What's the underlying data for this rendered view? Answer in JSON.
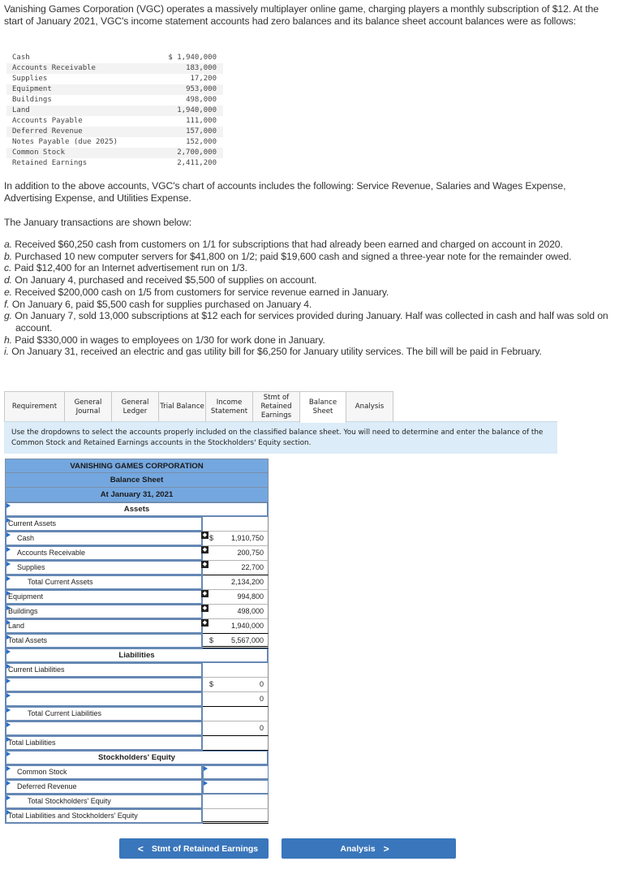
{
  "intro": {
    "p1": "Vanishing Games Corporation (VGC) operates a massively multiplayer online game, charging players a monthly subscription of $12. At the start of January 2021, VGC's income statement accounts had zero balances and its balance sheet account balances were as follows:",
    "p2": "In addition to the above accounts, VGC's chart of accounts includes the following: Service Revenue, Salaries and Wages Expense, Advertising Expense, and Utilities Expense.",
    "p3": "The January transactions are shown below:"
  },
  "beginning_balances": [
    {
      "account": "Cash",
      "amount": "$ 1,940,000"
    },
    {
      "account": "Accounts Receivable",
      "amount": "183,000"
    },
    {
      "account": "Supplies",
      "amount": "17,200"
    },
    {
      "account": "Equipment",
      "amount": "953,000"
    },
    {
      "account": "Buildings",
      "amount": "498,000"
    },
    {
      "account": "Land",
      "amount": "1,940,000"
    },
    {
      "account": "Accounts Payable",
      "amount": "111,000"
    },
    {
      "account": "Deferred Revenue",
      "amount": "157,000"
    },
    {
      "account": "Notes Payable (due 2025)",
      "amount": "152,000"
    },
    {
      "account": "Common Stock",
      "amount": "2,700,000"
    },
    {
      "account": "Retained Earnings",
      "amount": "2,411,200"
    }
  ],
  "transactions": [
    {
      "letter": "a.",
      "text": "Received $60,250 cash from customers on 1/1 for subscriptions that had already been earned and charged on account in 2020."
    },
    {
      "letter": "b.",
      "text": "Purchased 10 new computer servers for $41,800 on 1/2; paid $19,600 cash and signed a three-year note for the remainder owed."
    },
    {
      "letter": "c.",
      "text": "Paid $12,400 for an Internet advertisement run on 1/3."
    },
    {
      "letter": "d.",
      "text": "On January 4, purchased and received $5,500 of supplies on account."
    },
    {
      "letter": "e.",
      "text": "Received $200,000 cash on 1/5 from customers for service revenue earned in January."
    },
    {
      "letter": "f.",
      "text": "On January 6, paid $5,500 cash for supplies purchased on January 4."
    },
    {
      "letter": "g.",
      "text": "On January 7, sold 13,000 subscriptions at $12 each for services provided during January. Half was collected in cash and half was sold on account."
    },
    {
      "letter": "h.",
      "text": "Paid $330,000 in wages to employees on 1/30 for work done in January."
    },
    {
      "letter": "i.",
      "text": "On January 31, received an electric and gas utility bill for $6,250 for January utility services. The bill will be paid in February."
    }
  ],
  "tabs": [
    {
      "label": "Requirement",
      "active": false
    },
    {
      "label": "General Journal",
      "active": false
    },
    {
      "label": "General Ledger",
      "active": false
    },
    {
      "label": "Trial Balance",
      "active": false
    },
    {
      "label": "Income Statement",
      "active": false
    },
    {
      "label": "Stmt of Retained Earnings",
      "active": false
    },
    {
      "label": "Balance Sheet",
      "active": true
    },
    {
      "label": "Analysis",
      "active": false
    }
  ],
  "instructions": "Use the dropdowns to select the accounts properly included on the classified balance sheet. You will need to determine and enter the balance of the Common Stock and Retained Earnings accounts in the Stockholders' Equity section.",
  "balance_sheet": {
    "company": "VANISHING GAMES CORPORATION",
    "title": "Balance Sheet",
    "date": "At January 31, 2021",
    "assets_heading": "Assets",
    "liabilities_heading": "Liabilities",
    "equity_heading": "Stockholders' Equity",
    "rows": {
      "current_assets": {
        "label": "Current Assets",
        "value": ""
      },
      "cash": {
        "label": "Cash",
        "dollar": "$",
        "value": "1,910,750"
      },
      "accounts_receivable": {
        "label": "Accounts Receivable",
        "value": "200,750"
      },
      "supplies": {
        "label": "Supplies",
        "value": "22,700"
      },
      "total_current_assets": {
        "label": "Total Current Assets",
        "value": "2,134,200"
      },
      "equipment": {
        "label": "Equipment",
        "value": "994,800"
      },
      "buildings": {
        "label": "Buildings",
        "value": "498,000"
      },
      "land": {
        "label": "Land",
        "value": "1,940,000"
      },
      "total_assets": {
        "label": "Total Assets",
        "dollar": "$",
        "value": "5,567,000"
      },
      "current_liabilities": {
        "label": "Current Liabilities",
        "value": ""
      },
      "cl_line1": {
        "label": "",
        "dollar": "$",
        "value": "0"
      },
      "cl_line2": {
        "label": "",
        "value": "0"
      },
      "total_current_liabilities": {
        "label": "Total Current Liabilities",
        "value": ""
      },
      "ncl_line1": {
        "label": "",
        "value": "0"
      },
      "total_liabilities": {
        "label": "Total Liabilities",
        "value": ""
      },
      "common_stock": {
        "label": "Common Stock",
        "value": ""
      },
      "deferred_revenue": {
        "label": "Deferred Revenue",
        "value": ""
      },
      "total_equity": {
        "label": "Total Stockholders' Equity",
        "value": ""
      },
      "total_liab_equity": {
        "label": "Total Liabilities and Stockholders' Equity",
        "value": ""
      }
    }
  },
  "nav": {
    "prev_label": "Stmt of Retained Earnings",
    "prev_chevron": "<",
    "next_label": "Analysis",
    "next_chevron": ">"
  },
  "colors": {
    "header_blue": "#74a7df",
    "instruction_bg": "#dcecf8",
    "button_blue": "#3a76bb"
  }
}
